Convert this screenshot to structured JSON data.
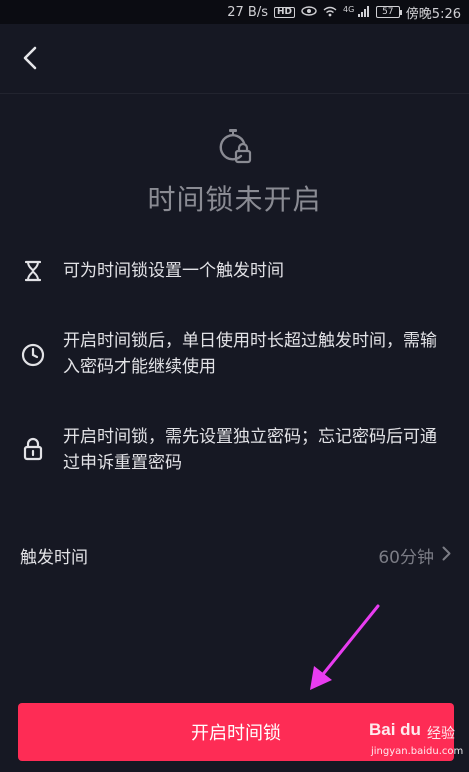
{
  "status_bar": {
    "speed": "27 B/s",
    "hd": "HD",
    "network": "4G",
    "battery": "57",
    "time": "傍晚5:26"
  },
  "header": {
    "back_icon": "chevron-left-icon"
  },
  "hero": {
    "icon": "stopwatch-lock-icon",
    "title": "时间锁未开启"
  },
  "features": [
    {
      "icon": "hourglass-icon",
      "text": "可为时间锁设置一个触发时间"
    },
    {
      "icon": "clock-icon",
      "text": "开启时间锁后，单日使用时长超过触发时间，需输入密码才能继续使用"
    },
    {
      "icon": "lock-icon",
      "text": "开启时间锁，需先设置独立密码；忘记密码后可通过申诉重置密码"
    }
  ],
  "trigger": {
    "label": "触发时间",
    "value": "60分钟"
  },
  "primary_button": {
    "label": "开启时间锁"
  },
  "watermark": {
    "logo": "Bai du",
    "logo_suffix": "经验",
    "url": "jingyan.baidu.com"
  },
  "colors": {
    "background": "#161823",
    "accent": "#fe2c55",
    "annotation": "#e83cf0"
  }
}
